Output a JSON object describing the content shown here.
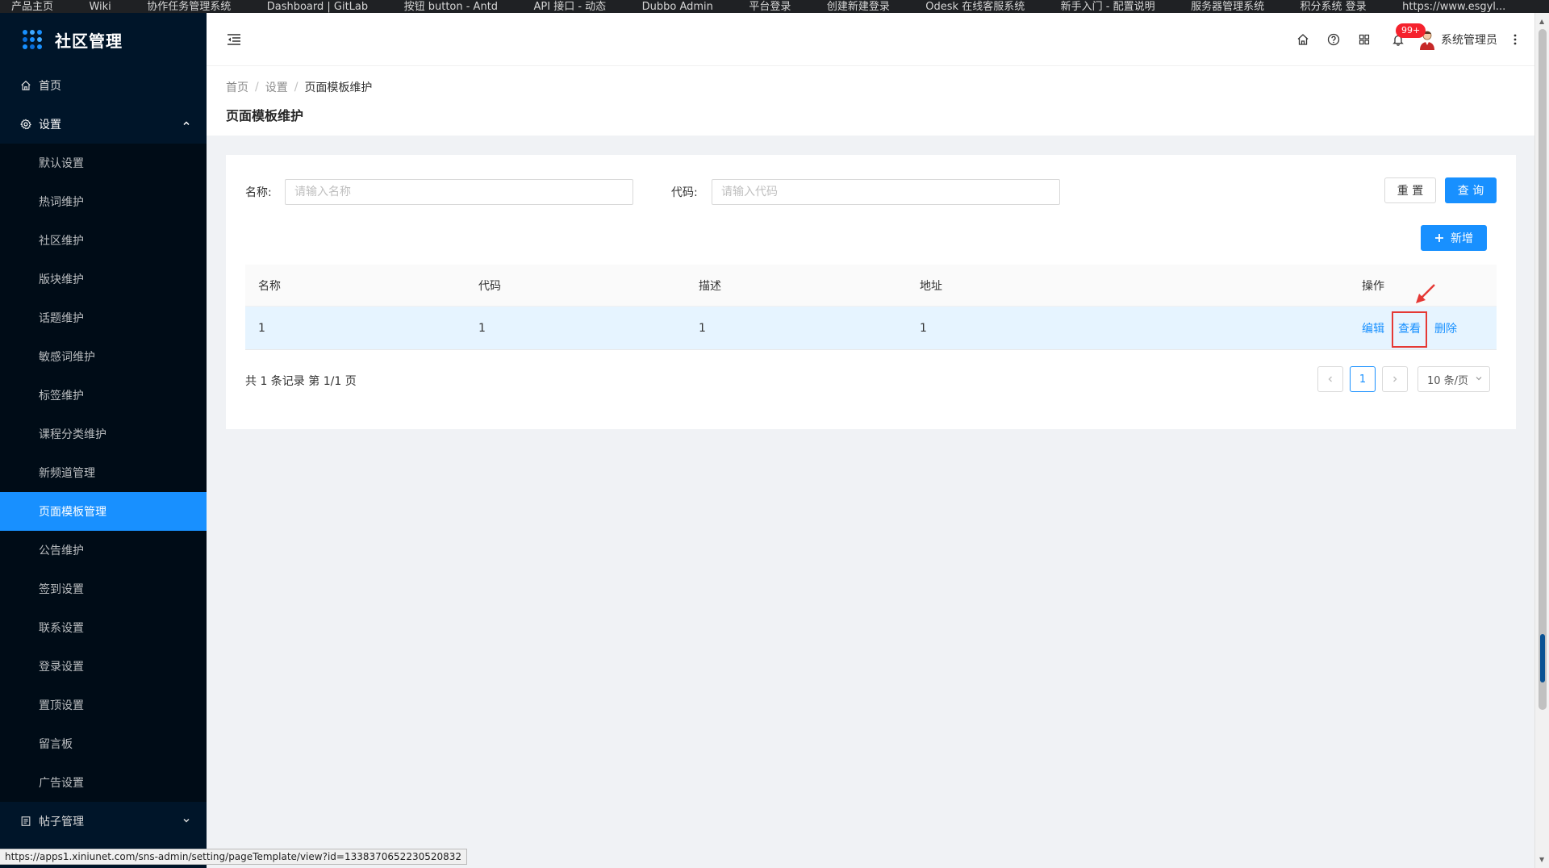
{
  "browser": {
    "bookmarks": [
      "产品主页",
      "Wiki",
      "协作任务管理系统",
      "Dashboard | GitLab",
      "按钮 button - Antd",
      "API 接口 - 动态",
      "Dubbo Admin",
      "平台登录",
      "创建新建登录",
      "Odesk 在线客服系统",
      "新手入门 - 配置说明",
      "服务器管理系统",
      "积分系统 登录",
      "https://www.esgyl..."
    ],
    "status_url": "https://apps1.xiniunet.com/sns-admin/setting/pageTemplate/view?id=1338370652230520832"
  },
  "sidebar": {
    "title": "社区管理",
    "home": "首页",
    "settings": "设置",
    "sub_items": [
      "默认设置",
      "热词维护",
      "社区维护",
      "版块维护",
      "话题维护",
      "敏感词维护",
      "标签维护",
      "课程分类维护",
      "新频道管理",
      "页面模板管理",
      "公告维护",
      "签到设置",
      "联系设置",
      "登录设置",
      "置顶设置",
      "留言板",
      "广告设置"
    ],
    "active_index": 9,
    "posts": "帖子管理"
  },
  "header": {
    "notification_count": "99+",
    "username": "系统管理员"
  },
  "breadcrumb": {
    "items": [
      "首页",
      "设置",
      "页面模板维护"
    ]
  },
  "page_title": "页面模板维护",
  "search": {
    "name_label": "名称:",
    "name_placeholder": "请输入名称",
    "code_label": "代码:",
    "code_placeholder": "请输入代码",
    "reset_label": "重 置",
    "query_label": "查 询",
    "add_label": "新增"
  },
  "table": {
    "columns": [
      "名称",
      "代码",
      "描述",
      "地址",
      "操作"
    ],
    "rows": [
      {
        "name": "1",
        "code": "1",
        "desc": "1",
        "address": "1",
        "actions": [
          "编辑",
          "查看",
          "删除"
        ]
      }
    ]
  },
  "pagination": {
    "summary": "共 1 条记录 第 1/1 页",
    "current_page": "1",
    "page_size": "10 条/页"
  },
  "colors": {
    "primary": "#1890ff",
    "sidebar_bg": "#001529",
    "annotation_red": "#e53935"
  }
}
